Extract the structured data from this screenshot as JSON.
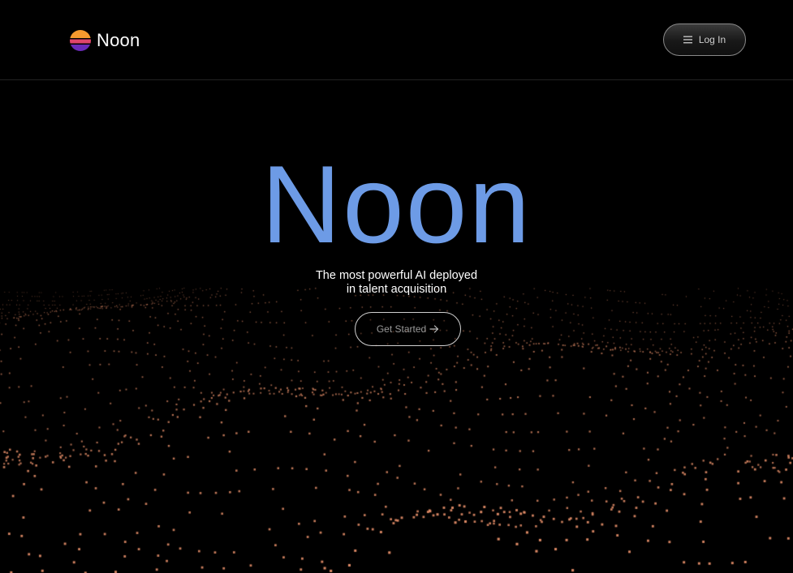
{
  "brand": {
    "name": "Noon",
    "logo_icon": "sunset-logo-icon"
  },
  "nav": {
    "login_label": "Log In",
    "menu_icon": "hamburger-menu-icon"
  },
  "hero": {
    "title": "Noon",
    "subtitle_line1": "The most powerful AI deployed",
    "subtitle_line2": "in talent acquisition",
    "cta_label": "Get Started",
    "cta_icon": "arrow-right-icon"
  },
  "colors": {
    "background": "#000000",
    "title": "#6d9be6",
    "particles": "#e8906a",
    "logo_top": "#f59a2e",
    "logo_middle": "#e0456b",
    "logo_bottom": "#6a2bb8"
  }
}
